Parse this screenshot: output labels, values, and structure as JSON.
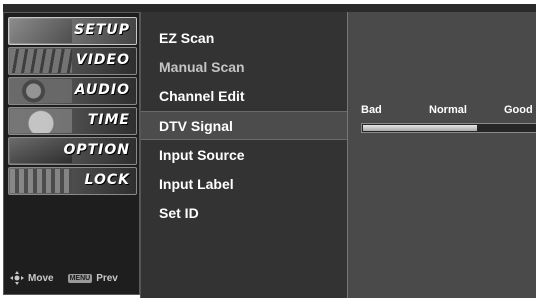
{
  "categories": [
    {
      "label": "SETUP",
      "icon": "satellite-dish-icon"
    },
    {
      "label": "VIDEO",
      "icon": "film-strip-icon"
    },
    {
      "label": "AUDIO",
      "icon": "speaker-icon"
    },
    {
      "label": "TIME",
      "icon": "clock-icon"
    },
    {
      "label": "OPTION",
      "icon": "option-icon"
    },
    {
      "label": "LOCK",
      "icon": "lock-icon"
    }
  ],
  "active_category": "SETUP",
  "hints": {
    "move_label": "Move",
    "menu_key": "MENU",
    "prev_label": "Prev"
  },
  "menu": {
    "items": [
      {
        "label": "EZ Scan"
      },
      {
        "label": "Manual Scan"
      },
      {
        "label": "Channel Edit"
      },
      {
        "label": "DTV Signal"
      },
      {
        "label": "Input Source"
      },
      {
        "label": "Input Label"
      },
      {
        "label": "Set ID"
      }
    ],
    "selected": "DTV Signal",
    "disabled": "Manual Scan"
  },
  "signal": {
    "bad_label": "Bad",
    "normal_label": "Normal",
    "good_label": "Good",
    "strength_fraction": 0.65
  }
}
